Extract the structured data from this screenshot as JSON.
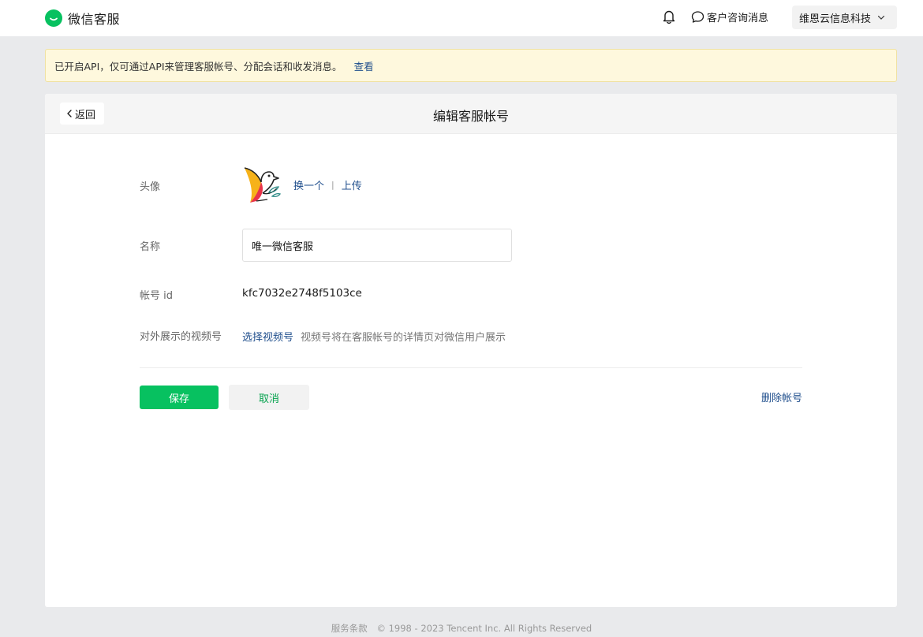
{
  "topbar": {
    "brand_title": "微信客服",
    "consult_label": "客户咨询消息",
    "company_label": "维恩云信息科技"
  },
  "notice": {
    "text": "已开启API，仅可通过API来管理客服帐号、分配会话和收发消息。",
    "link": "查看"
  },
  "card": {
    "back_label": "返回",
    "title": "编辑客服帐号"
  },
  "form": {
    "avatar_label": "头像",
    "change_label": "换一个",
    "separator": "|",
    "upload_label": "上传",
    "name_label": "名称",
    "name_value": "唯一微信客服",
    "id_label": "帐号 id",
    "id_value": "kfc7032e2748f5103ce",
    "video_label": "对外展示的视频号",
    "video_link": "选择视频号",
    "video_hint": "视频号将在客服帐号的详情页对微信用户展示"
  },
  "actions": {
    "save_label": "保存",
    "cancel_label": "取消",
    "delete_label": "删除帐号"
  },
  "footer": {
    "terms": "服务条款",
    "copyright": "© 1998 - 2023 Tencent Inc. All Rights Reserved"
  },
  "colors": {
    "brand_green": "#07c160",
    "link_blue": "#1f4e8c",
    "notice_bg": "#fef8dd"
  },
  "icons": [
    "wechat-kf-logo-icon",
    "bell-icon",
    "chat-bubble-icon",
    "chevron-down-icon",
    "chevron-left-icon",
    "bird-avatar"
  ]
}
